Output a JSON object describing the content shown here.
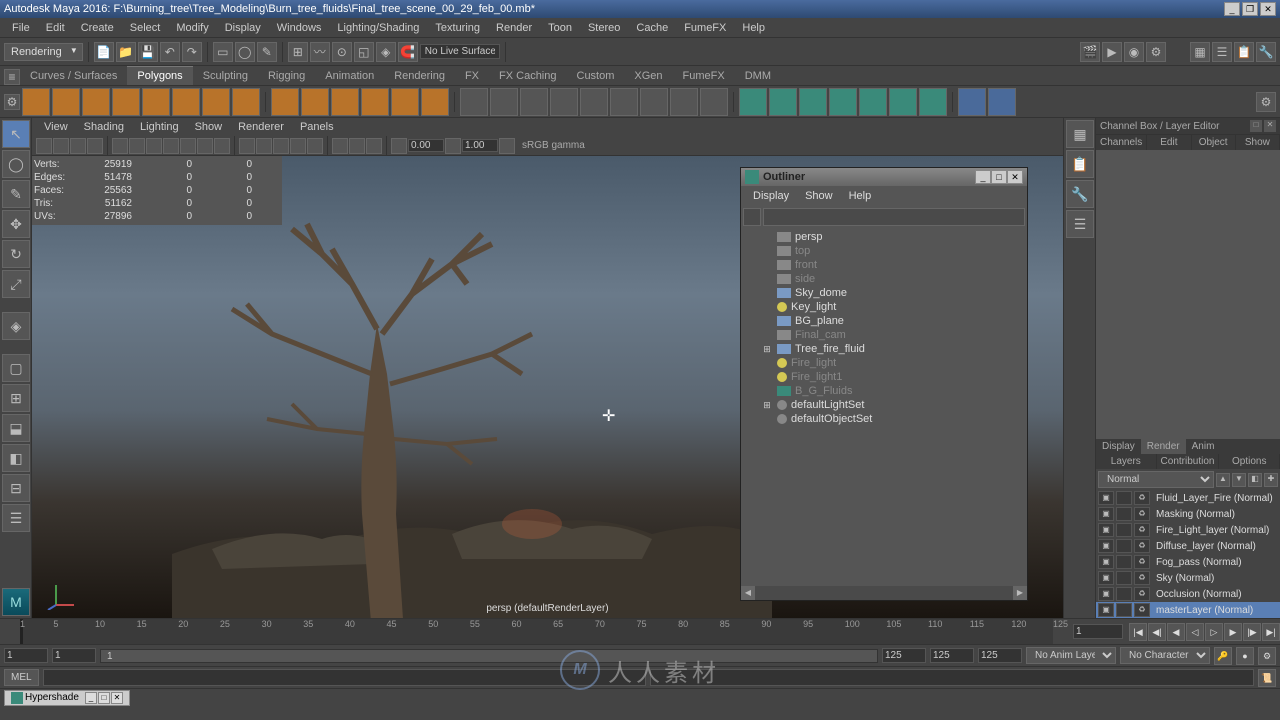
{
  "title_bar": {
    "text": "Autodesk Maya 2016: F:\\Burning_tree\\Tree_Modeling\\Burn_tree_fluids\\Final_tree_scene_00_29_feb_00.mb*"
  },
  "main_menu": [
    "File",
    "Edit",
    "Create",
    "Select",
    "Modify",
    "Display",
    "Windows",
    "Lighting/Shading",
    "Texturing",
    "Render",
    "Toon",
    "Stereo",
    "Cache",
    "FumeFX",
    "Help"
  ],
  "workspace_dropdown": "Rendering",
  "live_surface": "No Live Surface",
  "shelf_tabs": [
    "Curves / Surfaces",
    "Polygons",
    "Sculpting",
    "Rigging",
    "Animation",
    "Rendering",
    "FX",
    "FX Caching",
    "Custom",
    "XGen",
    "FumeFX",
    "DMM"
  ],
  "shelf_active": "Polygons",
  "viewport_menu": [
    "View",
    "Shading",
    "Lighting",
    "Show",
    "Renderer",
    "Panels"
  ],
  "viewport_nums": {
    "a": "0.00",
    "b": "1.00"
  },
  "viewport_colorspace": "sRGB gamma",
  "stats": [
    {
      "label": "Verts:",
      "v1": "25919",
      "v2": "0",
      "v3": "0"
    },
    {
      "label": "Edges:",
      "v1": "51478",
      "v2": "0",
      "v3": "0"
    },
    {
      "label": "Faces:",
      "v1": "25563",
      "v2": "0",
      "v3": "0"
    },
    {
      "label": "Tris:",
      "v1": "51162",
      "v2": "0",
      "v3": "0"
    },
    {
      "label": "UVs:",
      "v1": "27896",
      "v2": "0",
      "v3": "0"
    }
  ],
  "viewport_label": "persp (defaultRenderLayer)",
  "channel_box": {
    "header": "Channel Box / Layer Editor",
    "tabs": [
      "Channels",
      "Edit",
      "Object",
      "Show"
    ]
  },
  "render_tabs": [
    "Display",
    "Render",
    "Anim"
  ],
  "render_active": "Render",
  "layer_menu": [
    "Layers",
    "Contribution",
    "Options"
  ],
  "layer_mode": "Normal",
  "layers": [
    {
      "name": "Fluid_Layer_Fire (Normal)",
      "selected": false
    },
    {
      "name": "Masking (Normal)",
      "selected": false
    },
    {
      "name": "Fire_Light_layer (Normal)",
      "selected": false
    },
    {
      "name": "Diffuse_layer (Normal)",
      "selected": false
    },
    {
      "name": "Fog_pass (Normal)",
      "selected": false
    },
    {
      "name": "Sky (Normal)",
      "selected": false
    },
    {
      "name": "Occlusion (Normal)",
      "selected": false
    },
    {
      "name": "masterLayer (Normal)",
      "selected": true
    }
  ],
  "outliner": {
    "title": "Outliner",
    "menu": [
      "Display",
      "Show",
      "Help"
    ],
    "items": [
      {
        "label": "persp",
        "icon": "cam",
        "indent": 0,
        "dim": false
      },
      {
        "label": "top",
        "icon": "cam",
        "indent": 0,
        "dim": true
      },
      {
        "label": "front",
        "icon": "cam",
        "indent": 0,
        "dim": true
      },
      {
        "label": "side",
        "icon": "cam",
        "indent": 0,
        "dim": true
      },
      {
        "label": "Sky_dome",
        "icon": "mesh",
        "indent": 0,
        "dim": false
      },
      {
        "label": "Key_light",
        "icon": "light",
        "indent": 0,
        "dim": false
      },
      {
        "label": "BG_plane",
        "icon": "mesh",
        "indent": 0,
        "dim": false
      },
      {
        "label": "Final_cam",
        "icon": "cam",
        "indent": 0,
        "dim": true
      },
      {
        "label": "Tree_fire_fluid",
        "icon": "mesh",
        "indent": 0,
        "dim": false,
        "expand": true
      },
      {
        "label": "Fire_light",
        "icon": "light",
        "indent": 0,
        "dim": true
      },
      {
        "label": "Fire_light1",
        "icon": "light",
        "indent": 0,
        "dim": true
      },
      {
        "label": "B_G_Fluids",
        "icon": "fluid",
        "indent": 0,
        "dim": true
      },
      {
        "label": "defaultLightSet",
        "icon": "set",
        "indent": 0,
        "dim": false,
        "expand": true
      },
      {
        "label": "defaultObjectSet",
        "icon": "set",
        "indent": 0,
        "dim": false
      }
    ]
  },
  "timeline": {
    "ticks": [
      1,
      5,
      10,
      15,
      20,
      25,
      30,
      35,
      40,
      45,
      50,
      55,
      60,
      65,
      70,
      75,
      80,
      85,
      90,
      95,
      100,
      105,
      110,
      115,
      120,
      125
    ],
    "current": 1,
    "frame_display": "1"
  },
  "range": {
    "start": "1",
    "range_start": "1",
    "range_active": "1",
    "end": "125",
    "range_end": "125",
    "max": "125",
    "anim_layer": "No Anim Layer",
    "char_set": "No Character Set"
  },
  "command": {
    "type": "MEL"
  },
  "taskbar": {
    "hypershade": "Hypershade"
  },
  "watermark": {
    "logo": "M",
    "text": "人人素材"
  }
}
